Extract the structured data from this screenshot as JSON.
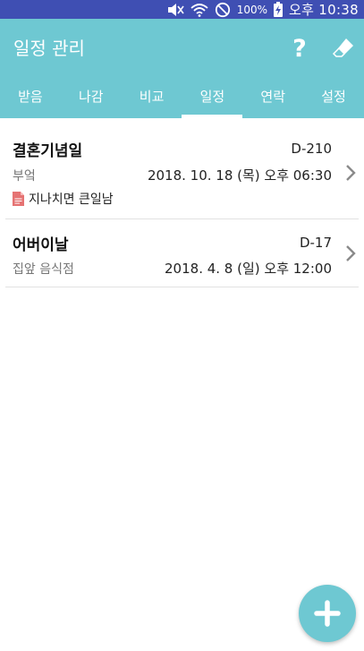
{
  "status_bar": {
    "battery_percent": "100%",
    "time": "오후 10:38",
    "icons": [
      "mute-icon",
      "wifi-icon",
      "no-entry-icon",
      "battery-charging-icon"
    ]
  },
  "app_bar": {
    "title": "일정 관리",
    "help_label": "?",
    "icons": [
      "help-icon",
      "eraser-icon"
    ]
  },
  "tabs": [
    {
      "label": "받음",
      "active": false
    },
    {
      "label": "나감",
      "active": false
    },
    {
      "label": "비교",
      "active": false
    },
    {
      "label": "일정",
      "active": true
    },
    {
      "label": "연락",
      "active": false
    },
    {
      "label": "설정",
      "active": false
    }
  ],
  "schedule": [
    {
      "title": "결혼기념일",
      "dday": "D-210",
      "category": "부엌",
      "datetime": "2018. 10. 18 (목) 오후 06:30",
      "note": "지나치면 큰일남",
      "note_icon": "memo-file-icon"
    },
    {
      "title": "어버이날",
      "dday": "D-17",
      "category": "집앞 음식점",
      "datetime": "2018. 4. 8 (일) 오후 12:00"
    }
  ],
  "fab": {
    "icon": "plus-icon"
  },
  "colors": {
    "status_bar": "#3f4fb3",
    "accent": "#6ec8d2",
    "divider": "#e1e1e1",
    "note_icon": "#e57373"
  }
}
